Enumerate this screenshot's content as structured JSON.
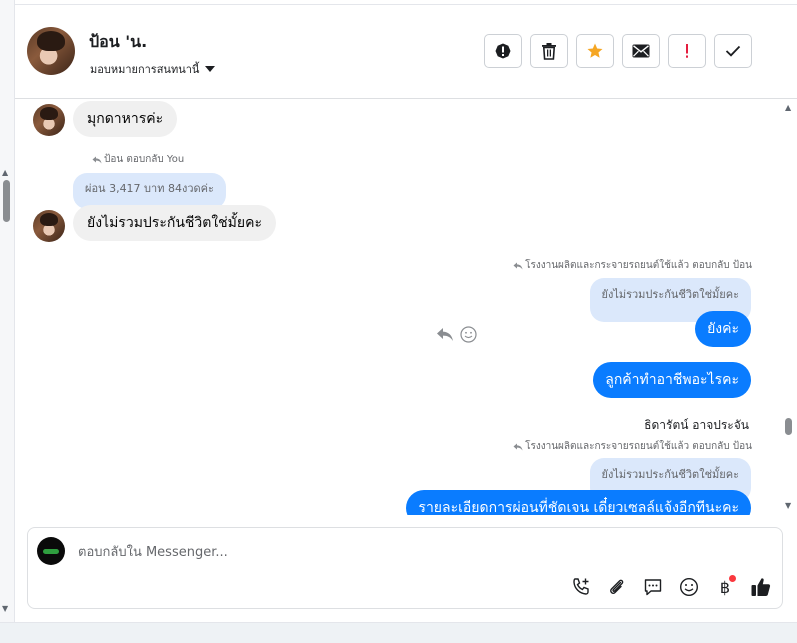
{
  "header": {
    "contact_name": "ป้อน 'น.",
    "assign_label": "มอบหมายการสนทนานี้"
  },
  "actions": [
    {
      "name": "alert-circle-button",
      "icon": "exclamation-circle-icon"
    },
    {
      "name": "trash-button",
      "icon": "trash-icon"
    },
    {
      "name": "star-button",
      "icon": "star-icon",
      "color": "#f5a623"
    },
    {
      "name": "mail-button",
      "icon": "envelope-icon"
    },
    {
      "name": "important-button",
      "icon": "exclamation-icon",
      "color": "#e41e3f"
    },
    {
      "name": "done-button",
      "icon": "checkmark-icon"
    }
  ],
  "messages": {
    "m1": "มุกดาหารค่ะ",
    "reply_label_1": "ป้อน ตอบกลับ You",
    "quote_1": "ผ่อน 3,417 บาท 84งวดค่ะ",
    "m2": "ยังไม่รวมประกันชีวิตใช่มั้ยคะ",
    "reply_label_2": "โรงงานผลิตและกระจายรถยนต์ใช้แล้ว ตอบกลับ ป้อน",
    "quote_2": "ยังไม่รวมประกันชีวิตใช่มั้ยคะ",
    "m3": "ยังค่ะ",
    "m4": "ลูกค้าทำอาชีพอะไรคะ",
    "sender_name": "ธิดารัตน์ อาจประจัน",
    "reply_label_3": "โรงงานผลิตและกระจายรถยนต์ใช้แล้ว ตอบกลับ ป้อน",
    "quote_3": "ยังไม่รวมประกันชีวิตใช่มั้ยคะ",
    "m5": "รายละเอียดการผ่อนที่ชัดเจน เดี๋ยวเซลล์แจ้งอีกทีนะคะ"
  },
  "composer": {
    "placeholder": "ตอบกลับใน Messenger...",
    "tools": [
      "phone-add-icon",
      "paperclip-icon",
      "chat-bubble-icon",
      "smiley-icon",
      "baht-icon",
      "thumbs-up-icon"
    ],
    "baht_symbol": "฿"
  },
  "colors": {
    "outgoing_bubble": "#0a7cff",
    "incoming_bubble": "#f0f0f0",
    "quote_bubble": "#dbe8fb"
  }
}
